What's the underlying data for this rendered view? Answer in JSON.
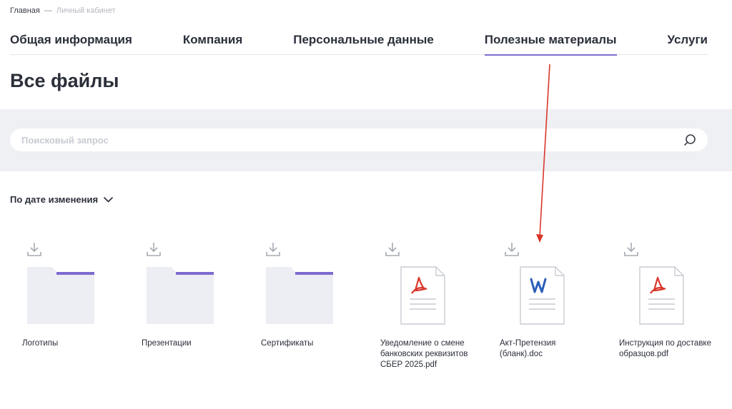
{
  "breadcrumb": {
    "home": "Главная",
    "separator": "—",
    "current": "Личный кабинет"
  },
  "tabs": [
    {
      "label": "Общая информация",
      "active": false
    },
    {
      "label": "Компания",
      "active": false
    },
    {
      "label": "Персональные данные",
      "active": false
    },
    {
      "label": "Полезные материалы",
      "active": true
    },
    {
      "label": "Услуги",
      "active": false
    }
  ],
  "page_title": "Все файлы",
  "search": {
    "placeholder": "Поисковый запрос",
    "value": ""
  },
  "sort": {
    "label": "По дате изменения"
  },
  "files": [
    {
      "type": "folder",
      "name": "Логотипы"
    },
    {
      "type": "folder",
      "name": "Презентации"
    },
    {
      "type": "folder",
      "name": "Сертификаты"
    },
    {
      "type": "pdf",
      "name": "Уведомление о смене банковских реквизитов СБЕР 2025.pdf"
    },
    {
      "type": "doc",
      "name": "Акт-Претензия (бланк).doc"
    },
    {
      "type": "pdf",
      "name": "Инструкция по доставке образцов.pdf"
    }
  ],
  "colors": {
    "accent": "#7d6bd0",
    "annotation_arrow": "#d9362b",
    "pdf": "#d9362b",
    "word": "#2b5eb8",
    "band": "#eef0f4"
  }
}
